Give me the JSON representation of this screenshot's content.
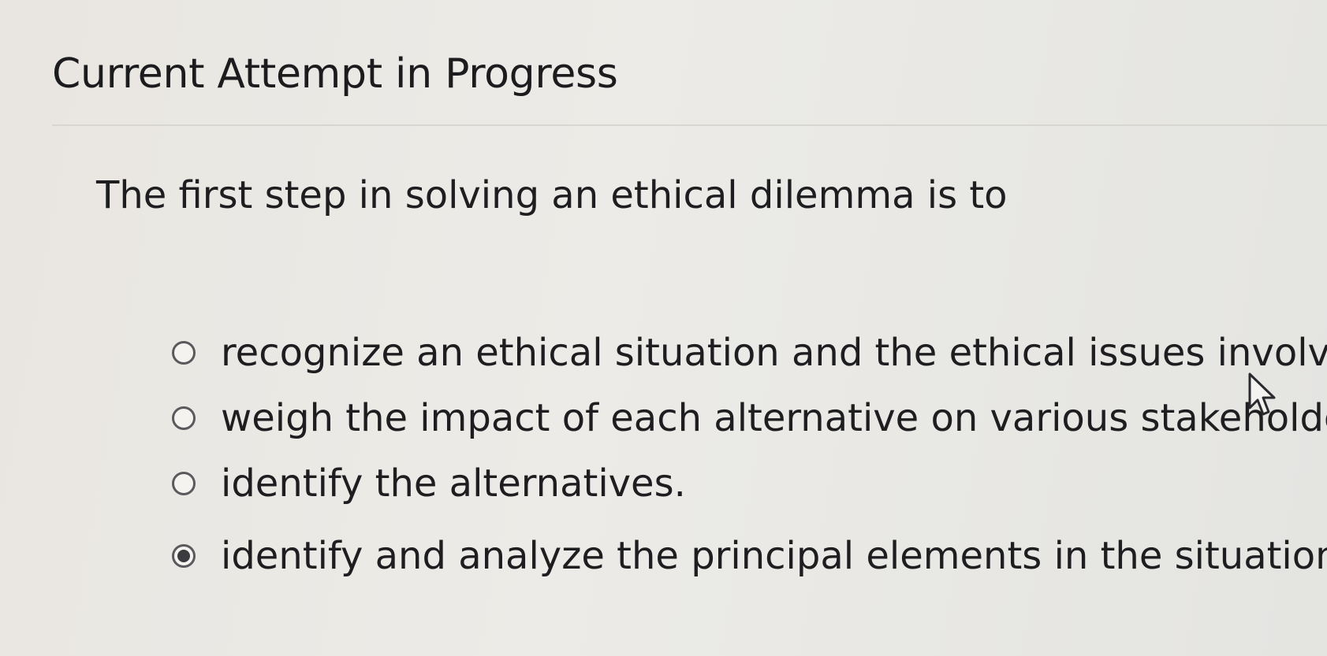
{
  "header": {
    "title": "Current Attempt in Progress"
  },
  "question": {
    "prompt": "The first step in solving an ethical dilemma is to",
    "options": [
      {
        "label": "recognize an ethical situation and the ethical issues involve",
        "selected": false
      },
      {
        "label": "weigh the impact of each alternative on various stakeholde",
        "selected": false
      },
      {
        "label": "identify the alternatives.",
        "selected": false
      },
      {
        "label": "identify and analyze the principal elements in the situation.",
        "selected": true
      }
    ]
  },
  "icons": {
    "cursor": "mouse-pointer-icon"
  }
}
